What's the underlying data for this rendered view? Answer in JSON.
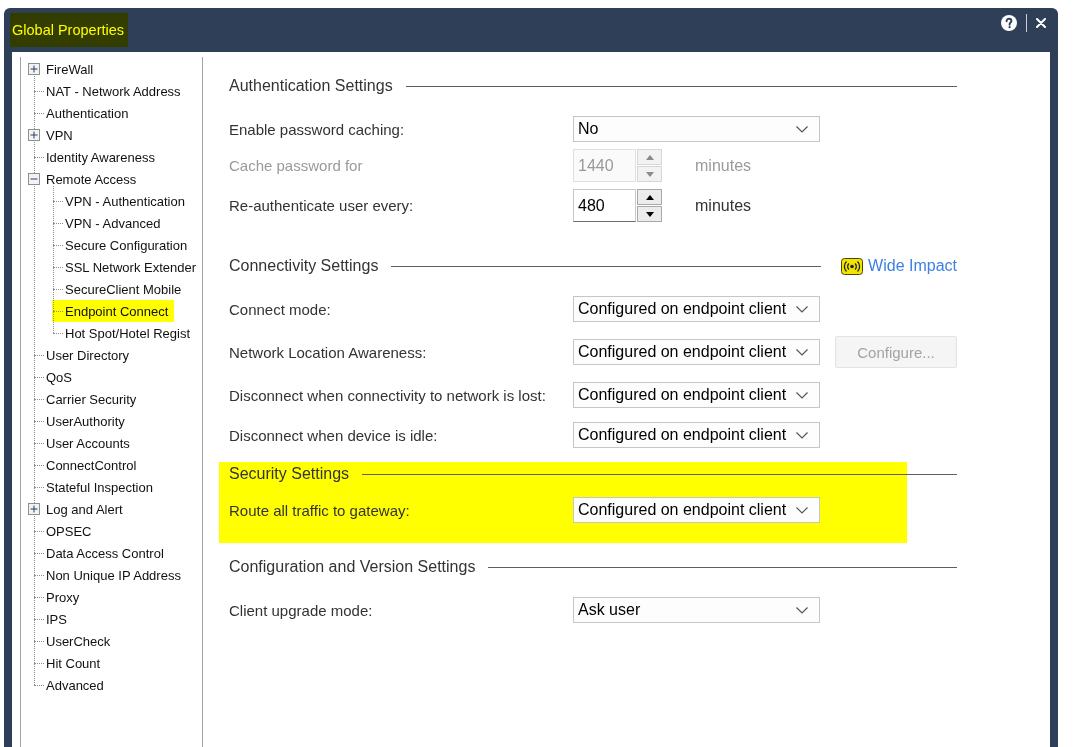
{
  "window": {
    "title": "Global Properties",
    "highlighted": true
  },
  "tree": [
    {
      "label": "FireWall",
      "expanded": false,
      "selected": false
    },
    {
      "label": "NAT - Network Address",
      "selected": false
    },
    {
      "label": "Authentication",
      "selected": false
    },
    {
      "label": "VPN",
      "expanded": false,
      "selected": false
    },
    {
      "label": "Identity Awareness",
      "selected": false
    },
    {
      "label": "Remote Access",
      "expanded": true,
      "selected": false,
      "children": [
        {
          "label": "VPN - Authentication",
          "selected": false
        },
        {
          "label": "VPN - Advanced",
          "selected": false
        },
        {
          "label": "Secure Configuration",
          "selected": false
        },
        {
          "label": "SSL Network Extender",
          "selected": false
        },
        {
          "label": "SecureClient Mobile",
          "selected": false
        },
        {
          "label": "Endpoint Connect",
          "selected": true
        },
        {
          "label": "Hot Spot/Hotel Regist",
          "selected": false
        }
      ]
    },
    {
      "label": "User Directory",
      "selected": false
    },
    {
      "label": "QoS",
      "selected": false
    },
    {
      "label": "Carrier Security",
      "selected": false
    },
    {
      "label": "UserAuthority",
      "selected": false
    },
    {
      "label": "User Accounts",
      "selected": false
    },
    {
      "label": "ConnectControl",
      "selected": false
    },
    {
      "label": "Stateful Inspection",
      "selected": false
    },
    {
      "label": "Log and Alert",
      "expanded": false,
      "selected": false
    },
    {
      "label": "OPSEC",
      "selected": false
    },
    {
      "label": "Data Access Control",
      "selected": false
    },
    {
      "label": "Non Unique IP Address",
      "selected": false
    },
    {
      "label": "Proxy",
      "selected": false
    },
    {
      "label": "IPS",
      "selected": false
    },
    {
      "label": "UserCheck",
      "selected": false
    },
    {
      "label": "Hit Count",
      "selected": false
    },
    {
      "label": "Advanced",
      "selected": false
    }
  ],
  "sections": [
    {
      "title": "Authentication Settings",
      "highlighted": false,
      "rows": [
        {
          "kind": "dropdown",
          "label": "Enable password caching:",
          "value": "No",
          "disabled": false
        },
        {
          "kind": "spinner",
          "label": "Cache password for",
          "value": "1440",
          "unit": "minutes",
          "disabled": true
        },
        {
          "kind": "spinner",
          "label": "Re-authenticate user every:",
          "value": "480",
          "unit": "minutes",
          "disabled": false
        }
      ]
    },
    {
      "title": "Connectivity Settings",
      "highlighted": false,
      "badge": {
        "label": "Wide Impact"
      },
      "rows": [
        {
          "kind": "dropdown",
          "label": "Connect mode:",
          "value": "Configured on endpoint client",
          "disabled": false
        },
        {
          "kind": "dropdown",
          "label": "Network Location Awareness:",
          "value": "Configured on endpoint client",
          "disabled": false,
          "button": {
            "label": "Configure...",
            "disabled": true
          }
        },
        {
          "kind": "dropdown",
          "label": "Disconnect when connectivity to network is lost:",
          "value": "Configured on endpoint client",
          "disabled": false
        },
        {
          "kind": "dropdown",
          "label": "Disconnect when device is idle:",
          "value": "Configured on endpoint client",
          "disabled": false
        }
      ]
    },
    {
      "title": "Security Settings",
      "highlighted": true,
      "rows": [
        {
          "kind": "dropdown",
          "label": "Route all traffic to gateway:",
          "value": "Configured on endpoint client",
          "disabled": false
        }
      ]
    },
    {
      "title": "Configuration and Version Settings",
      "highlighted": false,
      "rows": [
        {
          "kind": "dropdown",
          "label": "Client upgrade mode:",
          "value": "Ask user",
          "disabled": false
        }
      ]
    }
  ]
}
